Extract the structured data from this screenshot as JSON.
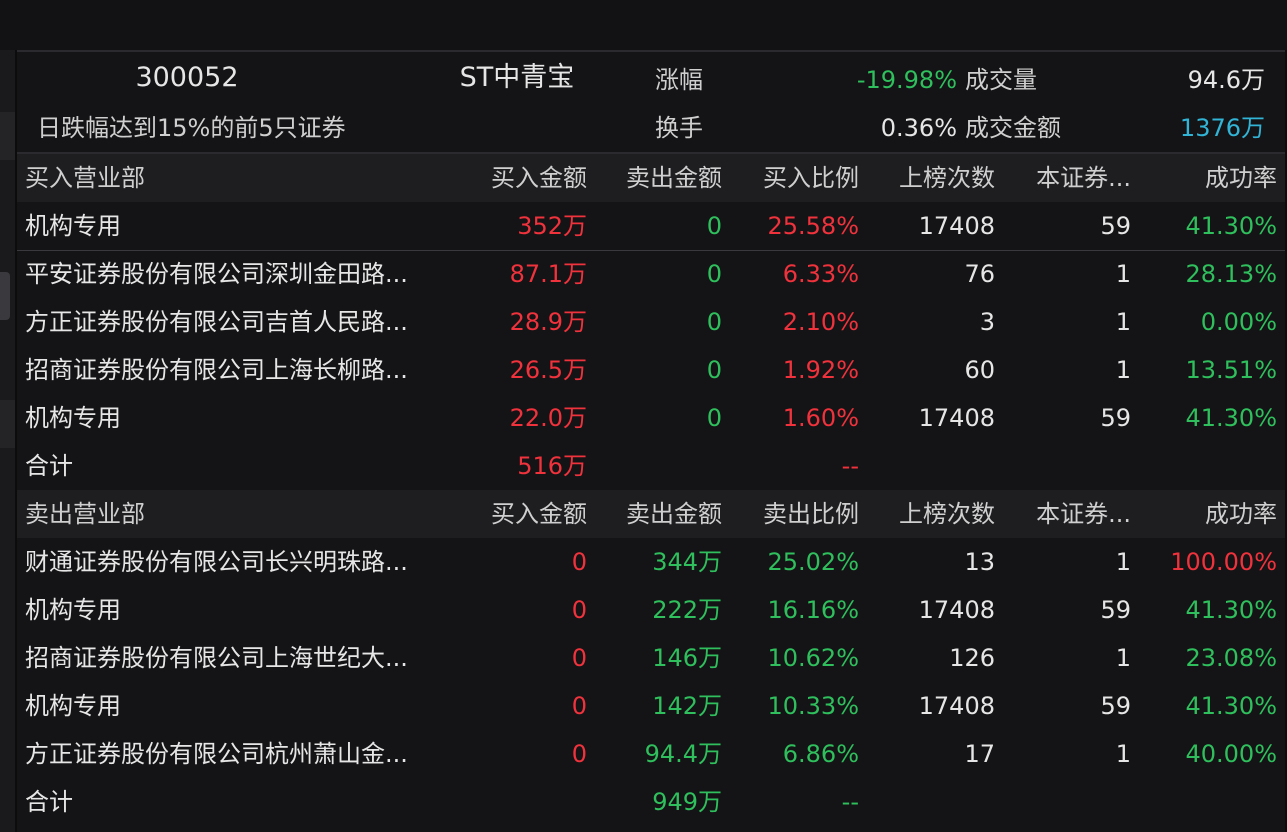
{
  "header": {
    "code": "300052",
    "name": "ST中青宝",
    "description": "日跌幅达到15%的前5只证券",
    "change_label": "涨幅",
    "change_value": "-19.98%",
    "volume_label": "成交量",
    "volume_value": "94.6万",
    "turnover_label": "换手",
    "turnover_value": "0.36%",
    "amount_label": "成交金额",
    "amount_value": "1376万"
  },
  "buy_section": {
    "columns": [
      "买入营业部",
      "买入金额",
      "卖出金额",
      "买入比例",
      "上榜次数",
      "本证券...",
      "成功率"
    ],
    "rows": [
      {
        "name": "机构专用",
        "buy": "352万",
        "sell": "0",
        "ratio": "25.58%",
        "times": "17408",
        "this": "59",
        "rate": "41.30%"
      },
      {
        "name": "平安证券股份有限公司深圳金田路...",
        "buy": "87.1万",
        "sell": "0",
        "ratio": "6.33%",
        "times": "76",
        "this": "1",
        "rate": "28.13%"
      },
      {
        "name": "方正证券股份有限公司吉首人民路...",
        "buy": "28.9万",
        "sell": "0",
        "ratio": "2.10%",
        "times": "3",
        "this": "1",
        "rate": "0.00%"
      },
      {
        "name": "招商证券股份有限公司上海长柳路...",
        "buy": "26.5万",
        "sell": "0",
        "ratio": "1.92%",
        "times": "60",
        "this": "1",
        "rate": "13.51%"
      },
      {
        "name": "机构专用",
        "buy": "22.0万",
        "sell": "0",
        "ratio": "1.60%",
        "times": "17408",
        "this": "59",
        "rate": "41.30%"
      }
    ],
    "total": {
      "label": "合计",
      "buy": "516万",
      "ratio": "--"
    }
  },
  "sell_section": {
    "columns": [
      "卖出营业部",
      "买入金额",
      "卖出金额",
      "卖出比例",
      "上榜次数",
      "本证券...",
      "成功率"
    ],
    "rows": [
      {
        "name": "财通证券股份有限公司长兴明珠路...",
        "buy": "0",
        "sell": "344万",
        "ratio": "25.02%",
        "times": "13",
        "this": "1",
        "rate": "100.00%"
      },
      {
        "name": "机构专用",
        "buy": "0",
        "sell": "222万",
        "ratio": "16.16%",
        "times": "17408",
        "this": "59",
        "rate": "41.30%"
      },
      {
        "name": "招商证券股份有限公司上海世纪大...",
        "buy": "0",
        "sell": "146万",
        "ratio": "10.62%",
        "times": "126",
        "this": "1",
        "rate": "23.08%"
      },
      {
        "name": "机构专用",
        "buy": "0",
        "sell": "142万",
        "ratio": "10.33%",
        "times": "17408",
        "this": "59",
        "rate": "41.30%"
      },
      {
        "name": "方正证券股份有限公司杭州萧山金...",
        "buy": "0",
        "sell": "94.4万",
        "ratio": "6.86%",
        "times": "17",
        "this": "1",
        "rate": "40.00%"
      }
    ],
    "total": {
      "label": "合计",
      "sell": "949万",
      "ratio": "--"
    }
  },
  "colors": {
    "up": "#f0323c",
    "down": "#2fbf5c",
    "accent": "#31b4d6",
    "background": "#141416"
  }
}
